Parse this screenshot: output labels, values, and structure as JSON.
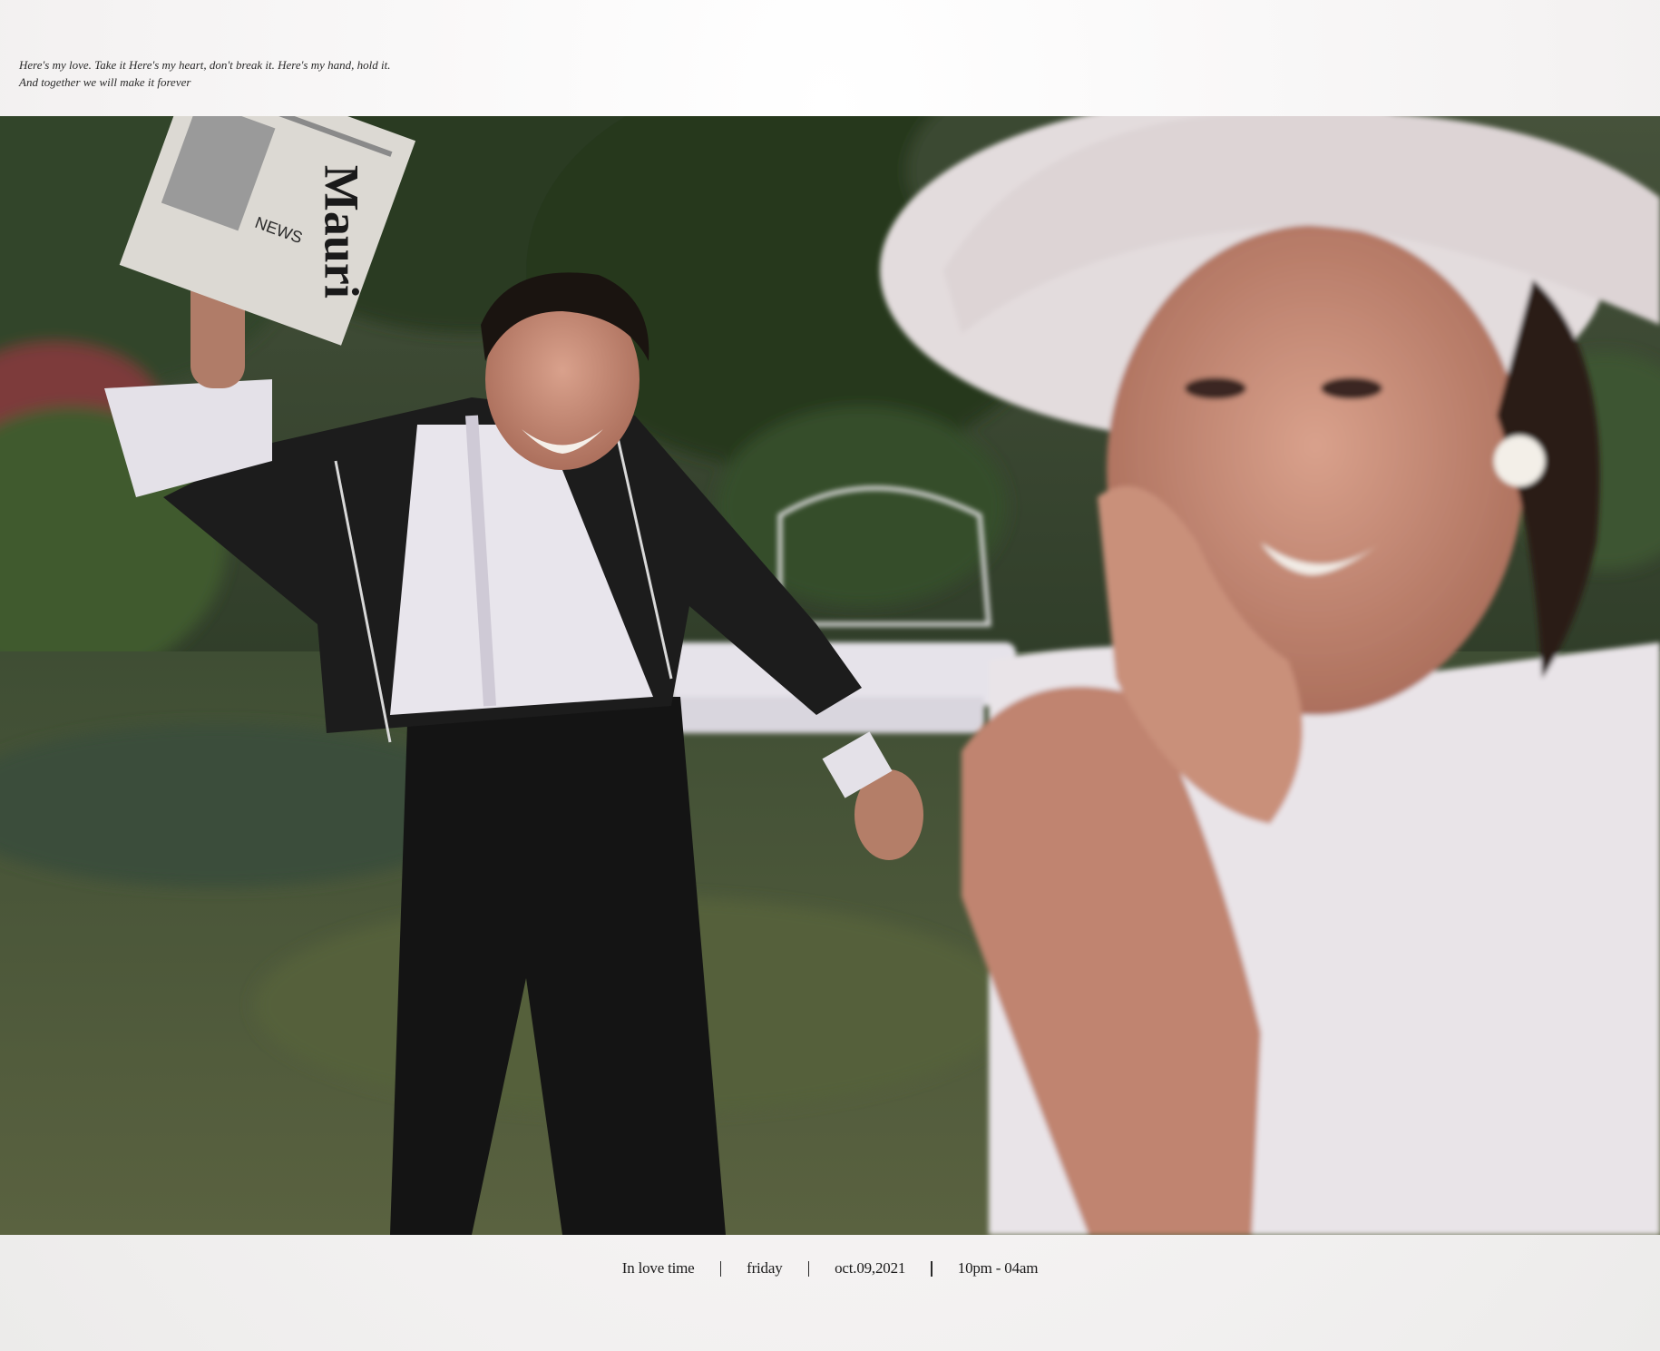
{
  "header": {
    "quote_line_1": "Here's my love. Take it Here's my heart, don't break it. Here's my hand, hold it.",
    "quote_line_2": "And together we will make it forever"
  },
  "photo": {
    "newspaper_text_1": "Mauri",
    "newspaper_text_2": "NEWS"
  },
  "footer": {
    "item_1": "In love time",
    "item_2": "friday",
    "item_3": "oct.09,2021",
    "item_4": "10pm - 04am"
  },
  "colors": {
    "background": "#f6f4f3",
    "foliage": "#2f3d27",
    "grass": "#4c5a37",
    "suit": "#1a1a1a",
    "shirt": "#e9e6ee",
    "hat": "#e2dadb",
    "skin": "#c98d78"
  }
}
